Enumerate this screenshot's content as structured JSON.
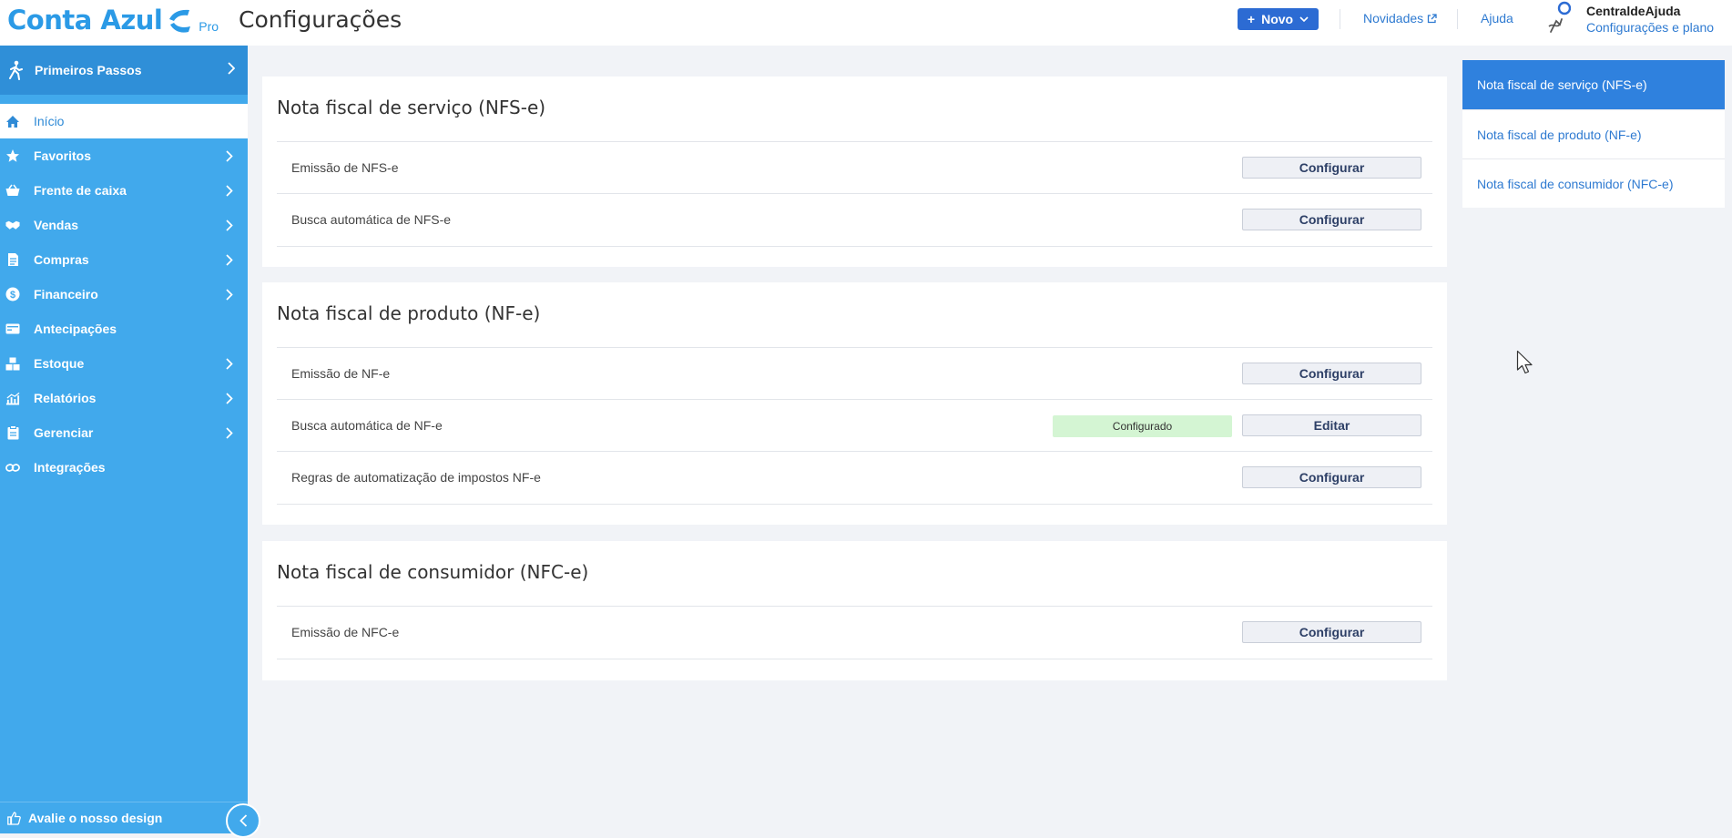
{
  "header": {
    "logo": {
      "text": "Conta Azul",
      "edition": "Pro"
    },
    "page_title": "Configurações",
    "new_button_label": "Novo",
    "links": {
      "news": "Novidades",
      "help": "Ajuda"
    },
    "user": {
      "name": "CentraldeAjuda",
      "subtitle": "Configurações e plano"
    }
  },
  "sidebar": {
    "first_steps": "Primeiros Passos",
    "items": [
      {
        "label": "Início",
        "icon": "home-icon",
        "active": true,
        "chevron": false
      },
      {
        "label": "Favoritos",
        "icon": "star-icon",
        "active": false,
        "chevron": true
      },
      {
        "label": "Frente de caixa",
        "icon": "basket-icon",
        "active": false,
        "chevron": true
      },
      {
        "label": "Vendas",
        "icon": "handshake-icon",
        "active": false,
        "chevron": true
      },
      {
        "label": "Compras",
        "icon": "document-icon",
        "active": false,
        "chevron": true
      },
      {
        "label": "Financeiro",
        "icon": "dollar-icon",
        "active": false,
        "chevron": true
      },
      {
        "label": "Antecipações",
        "icon": "card-icon",
        "active": false,
        "chevron": false
      },
      {
        "label": "Estoque",
        "icon": "boxes-icon",
        "active": false,
        "chevron": true
      },
      {
        "label": "Relatórios",
        "icon": "chart-icon",
        "active": false,
        "chevron": true
      },
      {
        "label": "Gerenciar",
        "icon": "clipboard-icon",
        "active": false,
        "chevron": true
      },
      {
        "label": "Integrações",
        "icon": "link-icon",
        "active": false,
        "chevron": false
      }
    ],
    "feedback": "Avalie o nosso design"
  },
  "sections": [
    {
      "title": "Nota fiscal de serviço (NFS-e)",
      "rows": [
        {
          "label": "Emissão de NFS-e",
          "button": "Configurar"
        },
        {
          "label": "Busca automática de NFS-e",
          "button": "Configurar"
        }
      ]
    },
    {
      "title": "Nota fiscal de produto (NF-e)",
      "rows": [
        {
          "label": "Emissão de NF-e",
          "button": "Configurar"
        },
        {
          "label": "Busca automática de NF-e",
          "status": "Configurado",
          "button": "Editar"
        },
        {
          "label": "Regras de automatização de impostos NF-e",
          "button": "Configurar"
        }
      ]
    },
    {
      "title": "Nota fiscal de consumidor (NFC-e)",
      "rows": [
        {
          "label": "Emissão de NFC-e",
          "button": "Configurar"
        }
      ]
    }
  ],
  "right_nav": [
    {
      "label": "Nota fiscal de serviço (NFS-e)",
      "active": true
    },
    {
      "label": "Nota fiscal de produto (NF-e)",
      "active": false
    },
    {
      "label": "Nota fiscal de consumidor (NFC-e)",
      "active": false
    }
  ],
  "colors": {
    "brand_blue": "#2b9ae6",
    "sidebar_bg": "#41a9ec",
    "primary_button": "#2c6bd3",
    "status_ok_bg": "#d4f5d3"
  }
}
